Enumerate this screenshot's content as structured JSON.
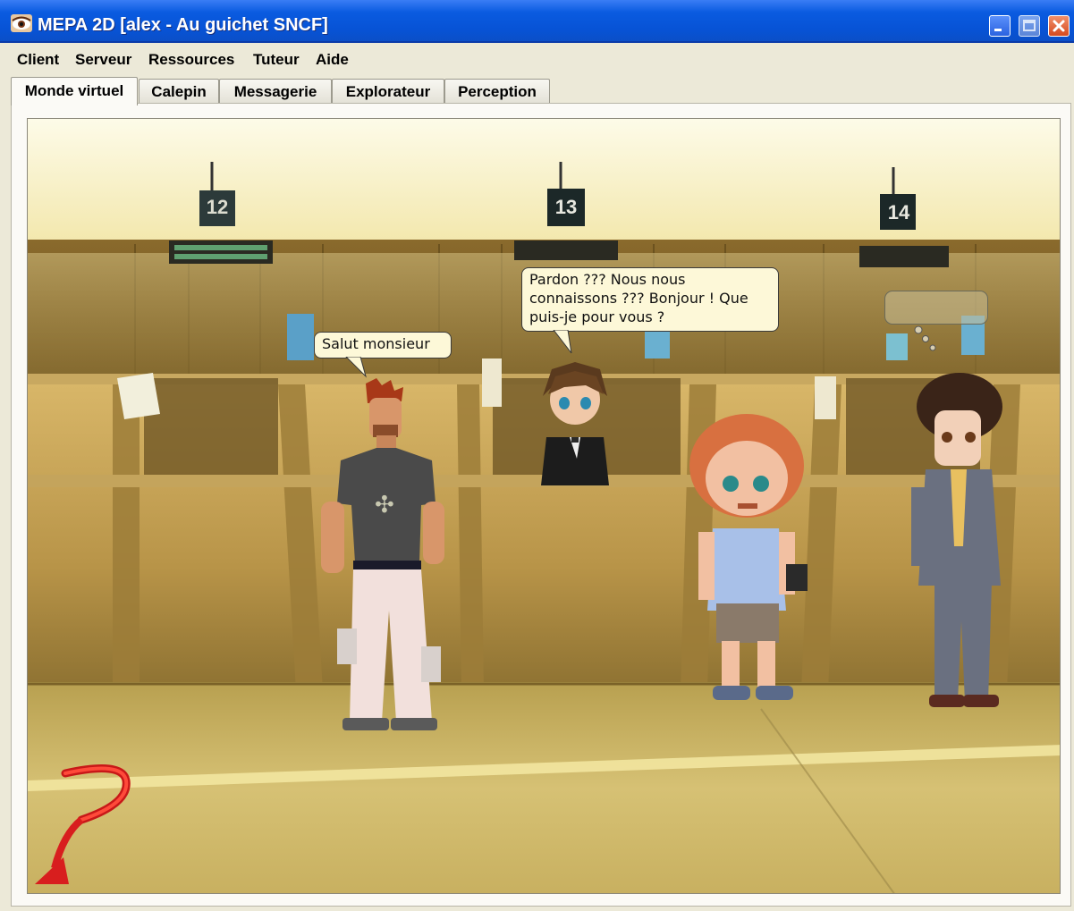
{
  "window": {
    "title": "MEPA 2D [alex - Au guichet SNCF]",
    "icon": "eye-icon",
    "controls": [
      "minimize-icon",
      "maximize-icon",
      "close-icon"
    ]
  },
  "menu": {
    "items": [
      "Client",
      "Serveur",
      "Ressources",
      "Tuteur",
      "Aide"
    ]
  },
  "tabs": {
    "items": [
      "Monde virtuel",
      "Calepin",
      "Messagerie",
      "Explorateur",
      "Perception"
    ],
    "active": "Monde virtuel"
  },
  "scene": {
    "counters": [
      "12",
      "13",
      "14"
    ],
    "bubbles": {
      "player": "Salut monsieur",
      "clerk": "Pardon ??? Nous nous connaissons ??? Bonjour ! Que puis-je pour vous ?",
      "thought": ""
    },
    "back_icon": "back-arrow-icon"
  },
  "colors": {
    "titlebar": "#0753d6",
    "window_bg": "#ece9d8",
    "bubble_bg": "#fdf8d8",
    "back_arrow": "#d81e1e"
  }
}
